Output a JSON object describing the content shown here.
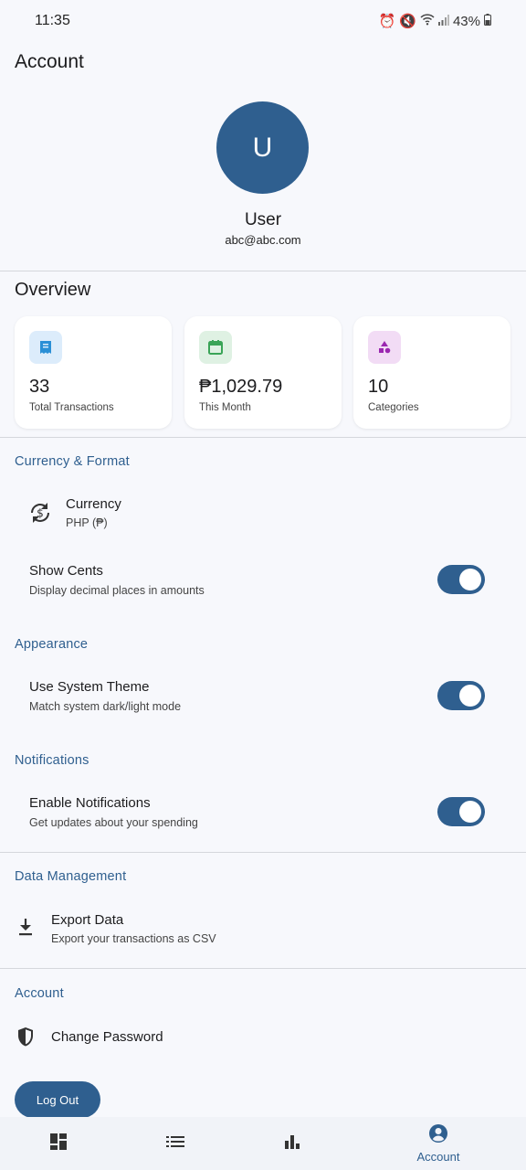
{
  "status_bar": {
    "time": "11:35",
    "battery": "43%"
  },
  "header": {
    "title": "Account"
  },
  "profile": {
    "initial": "U",
    "name": "User",
    "email": "abc@abc.com"
  },
  "overview": {
    "heading": "Overview",
    "cards": [
      {
        "value": "33",
        "label": "Total Transactions",
        "icon": "receipt-icon",
        "color": "#2a8fd6"
      },
      {
        "value": "₱1,029.79",
        "label": "This Month",
        "icon": "calendar-icon",
        "color": "#3aa457"
      },
      {
        "value": "10",
        "label": "Categories",
        "icon": "category-icon",
        "color": "#9b27b0"
      }
    ]
  },
  "currency_format": {
    "heading": "Currency & Format",
    "currency": {
      "title": "Currency",
      "sub": "PHP (₱)"
    },
    "show_cents": {
      "title": "Show Cents",
      "sub": "Display decimal places in amounts",
      "on": true
    }
  },
  "appearance": {
    "heading": "Appearance",
    "system_theme": {
      "title": "Use System Theme",
      "sub": "Match system dark/light mode",
      "on": true
    }
  },
  "notifications": {
    "heading": "Notifications",
    "enable": {
      "title": "Enable Notifications",
      "sub": "Get updates about your spending",
      "on": true
    }
  },
  "data_management": {
    "heading": "Data Management",
    "export": {
      "title": "Export Data",
      "sub": "Export your transactions as CSV"
    }
  },
  "account": {
    "heading": "Account",
    "change_password": "Change Password",
    "logout": "Log Out"
  },
  "bottom_nav": {
    "account_label": "Account"
  },
  "colors": {
    "accent": "#2f5f8f",
    "background": "#f7f8fc"
  }
}
